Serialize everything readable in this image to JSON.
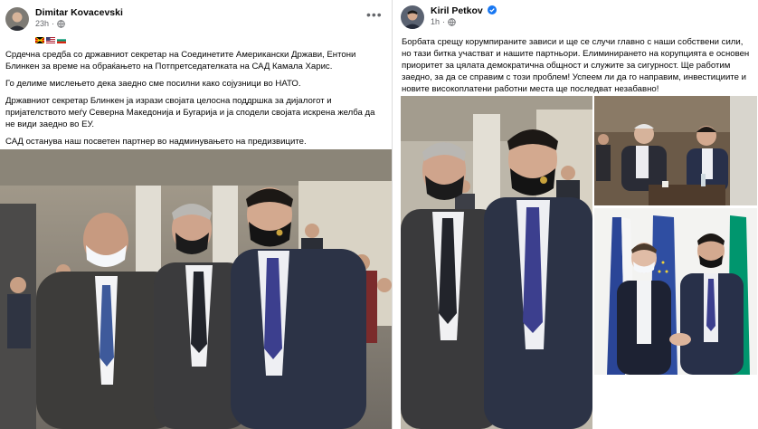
{
  "left_post": {
    "author": "Dimitar Kovacevski",
    "time": "23h",
    "separator": "·",
    "paragraphs": [
      "Срдечна средба со државниот секретар на Соединетите Американски Држави, Ентони Блинкен за време на обраќањето на Потпретседателката на САД Камала Харис.",
      "Го делиме мислењето дека заедно сме посилни како сојузници во НАТО.",
      "Државниот секретар Блинкен ја изрази својата целосна поддршка за дијалогот и пријателството меѓу Северна Македонија и Бугарија и ја сподели својата искрена желба да не види заедно во ЕУ.",
      "САД останува наш посветен партнер во надминувањето на предизвиците."
    ]
  },
  "right_post": {
    "author": "Kiril Petkov",
    "time": "1h",
    "separator": "·",
    "text": "Борбата срещу корумпираните зависи и ще се случи главно с наши собствени сили, но тази битка участват и нашите партньори. Елиминирането на корупцията е основен приоритет за цялата демократична общност и служите за сигурност. Ще работим заедно, за да се справим с този проблем! Успеем ли да го направим, инвестициите и новите високоплатени работни места ще последват незабавно!"
  },
  "icons": {
    "more": "more-options-icon",
    "globe": "globe-icon",
    "verified": "verified-badge-icon"
  },
  "colors": {
    "facebook_blue": "#1877f2",
    "secondary_text": "#65676b"
  }
}
